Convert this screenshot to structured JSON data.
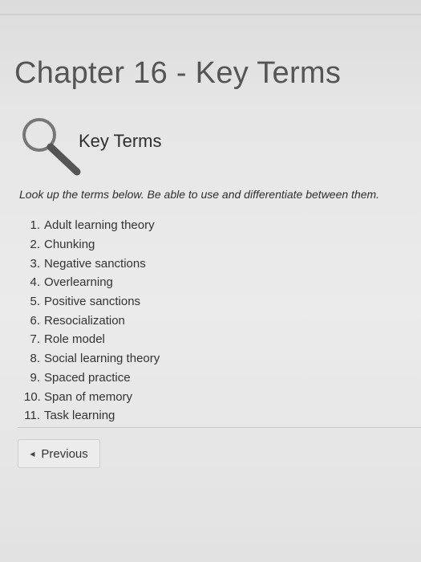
{
  "page": {
    "title": "Chapter 16 - Key Terms"
  },
  "section": {
    "icon": "magnifying-glass-icon",
    "title": "Key Terms",
    "instructions": "Look up the terms below.  Be able to use and differentiate between them."
  },
  "terms": [
    {
      "num": "1.",
      "label": "Adult learning theory"
    },
    {
      "num": "2.",
      "label": "Chunking"
    },
    {
      "num": "3.",
      "label": "Negative sanctions"
    },
    {
      "num": "4.",
      "label": "Overlearning"
    },
    {
      "num": "5.",
      "label": "Positive sanctions"
    },
    {
      "num": "6.",
      "label": "Resocialization"
    },
    {
      "num": "7.",
      "label": "Role model"
    },
    {
      "num": "8.",
      "label": "Social learning theory"
    },
    {
      "num": "9.",
      "label": "Spaced practice"
    },
    {
      "num": "10.",
      "label": "Span of memory"
    },
    {
      "num": "11.",
      "label": "Task learning"
    }
  ],
  "navigation": {
    "previous_label": "Previous",
    "previous_icon": "left-arrow-icon"
  }
}
